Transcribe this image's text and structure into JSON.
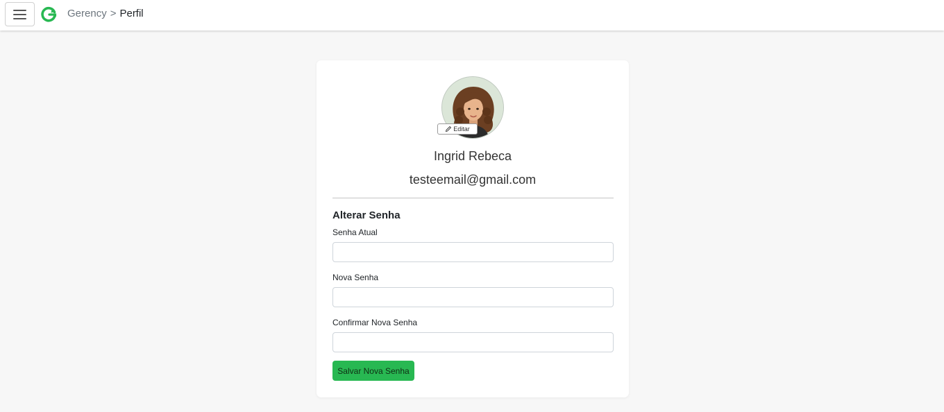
{
  "navbar": {
    "menu_icon": "hamburger-menu-icon",
    "logo_icon": "refresh-logo-icon",
    "brand_color": "#28b852",
    "breadcrumb": {
      "root": "Gerency",
      "separator": ">",
      "current": "Perfil"
    }
  },
  "profile": {
    "avatar_icon": "user-avatar",
    "edit_icon": "pencil-icon",
    "edit_label": "Editar",
    "name": "Ingrid Rebeca",
    "email": "testeemail@gmail.com"
  },
  "password_form": {
    "title": "Alterar Senha",
    "current_password_label": "Senha Atual",
    "current_password_value": "",
    "new_password_label": "Nova Senha",
    "new_password_value": "",
    "confirm_password_label": "Confirmar Nova Senha",
    "confirm_password_value": "",
    "submit_label": "Salvar Nova Senha",
    "submit_color": "#28b852"
  }
}
